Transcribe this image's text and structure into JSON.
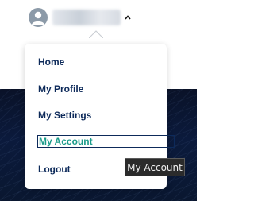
{
  "user_bar": {
    "avatar_icon": "user-avatar-icon",
    "caret_icon": "chevron-up-icon"
  },
  "dropdown": {
    "items": [
      {
        "label": "Home"
      },
      {
        "label": "My Profile"
      },
      {
        "label": "My Settings"
      },
      {
        "label": "My Account",
        "focused": true
      },
      {
        "label": "Logout"
      }
    ]
  },
  "tooltip": {
    "text": "My Account"
  },
  "colors": {
    "menu_text": "#0d2a5a",
    "focused_text": "#1a9b8a",
    "tooltip_bg": "#2b2b2b",
    "background_dark": "#0b1a3c"
  }
}
